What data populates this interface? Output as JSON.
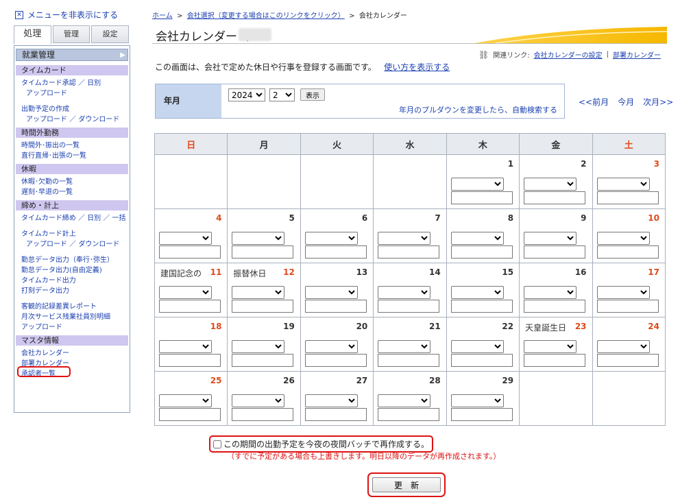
{
  "toggle": {
    "label": "メニューを非表示にする"
  },
  "tabs": [
    "処理",
    "管理",
    "設定"
  ],
  "sidebar": {
    "header": "就業管理",
    "sections": [
      {
        "title": "タイムカード",
        "links": [
          {
            "label": "タイムカード承認 ／ 日別",
            "indent": false
          },
          {
            "label": "アップロード",
            "indent": true
          },
          {
            "gap": true
          },
          {
            "label": "出勤予定の作成",
            "indent": false
          },
          {
            "label": "アップロード ／ ダウンロード",
            "indent": true
          }
        ]
      },
      {
        "title": "時間外勤務",
        "links": [
          {
            "label": "時間外･振出の一覧",
            "indent": false
          },
          {
            "label": "直行直帰･出張の一覧",
            "indent": false
          }
        ]
      },
      {
        "title": "休暇",
        "links": [
          {
            "label": "休暇･欠勤の一覧",
            "indent": false
          },
          {
            "label": "遅刻･早退の一覧",
            "indent": false
          }
        ]
      },
      {
        "title": "締め・計上",
        "links": [
          {
            "label": "タイムカード締め ／ 日別 ／ 一括",
            "indent": false
          },
          {
            "gap": true
          },
          {
            "label": "タイムカード計上",
            "indent": false
          },
          {
            "label": "アップロード ／ ダウンロード",
            "indent": true
          },
          {
            "gap": true
          },
          {
            "label": "勤怠データ出力（奉行･弥生）",
            "indent": false
          },
          {
            "label": "勤怠データ出力(自由定義)",
            "indent": false
          },
          {
            "label": "タイムカード出力",
            "indent": false
          },
          {
            "label": "打刻データ出力",
            "indent": false
          },
          {
            "gap": true
          },
          {
            "label": "客観的記録差異レポート",
            "indent": false
          },
          {
            "label": "月次サービス残業社員別明細",
            "indent": false
          },
          {
            "label": "アップロード",
            "indent": false
          }
        ]
      },
      {
        "title": "マスタ情報",
        "links": [
          {
            "label": "会社カレンダー",
            "indent": false
          },
          {
            "label": "部署カレンダー",
            "indent": false
          },
          {
            "label": "承認者一覧",
            "indent": false
          }
        ]
      }
    ]
  },
  "breadcrumb": {
    "home": "ホーム",
    "sep": ">",
    "company": "会社選択（変更する場合はこのリンクをクリック）",
    "current": "会社カレンダー"
  },
  "page": {
    "title": "会社カレンダー（"
  },
  "related": {
    "label": "関連リンク:",
    "link1": "会社カレンダーの設定",
    "sep": "|",
    "link2": "部署カレンダー"
  },
  "description": {
    "text": "この画面は、会社で定めた休日や行事を登録する画面です。",
    "help_link": "使い方を表示する"
  },
  "ym": {
    "label": "年月",
    "year": "2024",
    "month": "2",
    "show_button": "表示",
    "hint": "年月のプルダウンを変更したら、自動検索する"
  },
  "month_nav": {
    "prev": "<<前月",
    "current": "今月",
    "next": "次月>>"
  },
  "calendar": {
    "weekdays": [
      "日",
      "月",
      "火",
      "水",
      "木",
      "金",
      "土"
    ],
    "weeks": [
      [
        null,
        null,
        null,
        null,
        {
          "day": "1"
        },
        {
          "day": "2"
        },
        {
          "day": "3",
          "red": true
        }
      ],
      [
        {
          "day": "4",
          "red": true
        },
        {
          "day": "5"
        },
        {
          "day": "6"
        },
        {
          "day": "7"
        },
        {
          "day": "8"
        },
        {
          "day": "9"
        },
        {
          "day": "10",
          "red": true
        }
      ],
      [
        {
          "day": "11",
          "red": true,
          "holiday": "建国記念の"
        },
        {
          "day": "12",
          "red": true,
          "holiday": "振替休日"
        },
        {
          "day": "13"
        },
        {
          "day": "14"
        },
        {
          "day": "15"
        },
        {
          "day": "16"
        },
        {
          "day": "17",
          "red": true
        }
      ],
      [
        {
          "day": "18",
          "red": true
        },
        {
          "day": "19"
        },
        {
          "day": "20"
        },
        {
          "day": "21"
        },
        {
          "day": "22"
        },
        {
          "day": "23",
          "red": true,
          "holiday": "天皇誕生日"
        },
        {
          "day": "24",
          "red": true
        }
      ],
      [
        {
          "day": "25",
          "red": true
        },
        {
          "day": "26"
        },
        {
          "day": "27"
        },
        {
          "day": "28"
        },
        {
          "day": "29"
        },
        null,
        null
      ]
    ]
  },
  "rebuild": {
    "checkbox_label": "この期間の出勤予定を今夜の夜間バッチで再作成する。",
    "note": "（すでに予定がある場合も上書きします。明日以降のデータが再作成されます。）"
  },
  "update_button": "更　新",
  "colors": {
    "holiday": "#e04a1a",
    "link": "#1a3fb0",
    "highlight": "#d11111",
    "accent": "#f5b800"
  }
}
